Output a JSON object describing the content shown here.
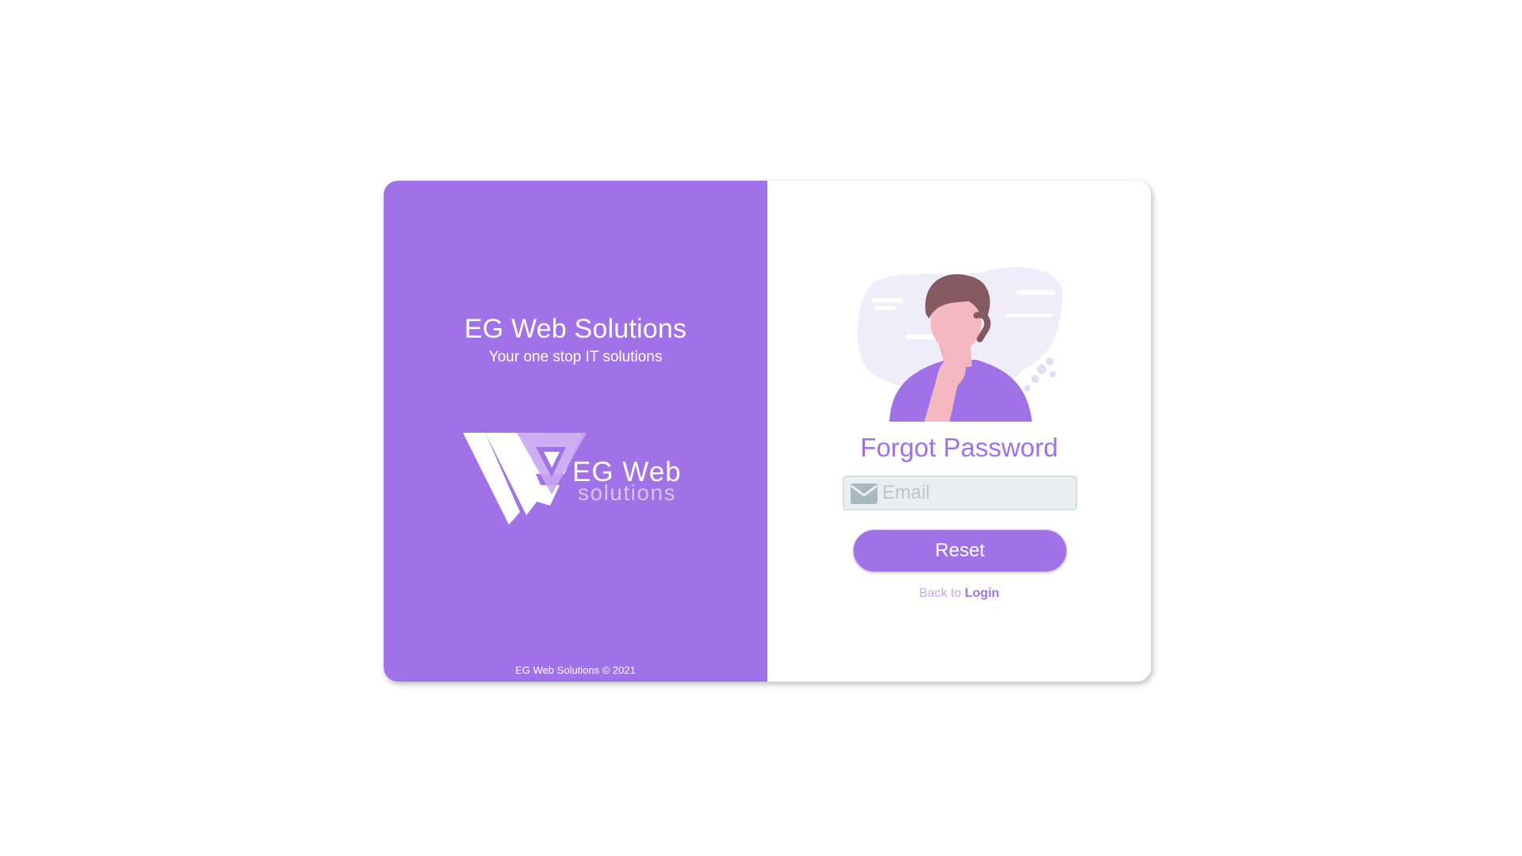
{
  "brand": {
    "title": "EG Web Solutions",
    "tagline": "Your one stop IT solutions",
    "logo_text": "EG Web",
    "logo_subtext": "solutions",
    "copyright": "EG Web Solutions © 2021"
  },
  "form": {
    "title": "Forgot Password",
    "email_placeholder": "Email",
    "email_value": "",
    "reset_label": "Reset",
    "back_prefix": "Back to ",
    "login_label": "Login"
  },
  "icons": {
    "email": "envelope-icon",
    "illustration": "thinking-person-illustration",
    "logo": "eg-web-solutions-logo"
  },
  "colors": {
    "primary": "#a172e7",
    "light_primary": "#c6a8f0",
    "input_background": "#e9eef0",
    "white": "#ffffff"
  }
}
